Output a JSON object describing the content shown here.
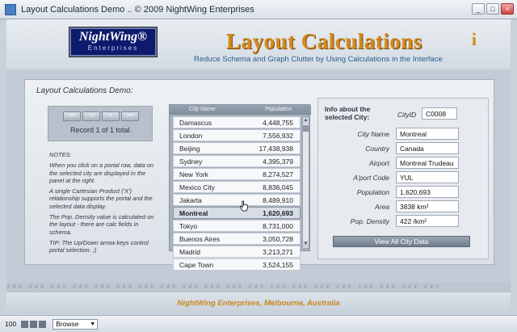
{
  "window": {
    "title": "Layout Calculations Demo  ..  © 2009 NightWing Enterprises",
    "controls": [
      "_",
      "□",
      "×"
    ]
  },
  "header": {
    "logo_main": "NightWing®",
    "logo_sub": "Enterprises",
    "title": "Layout Calculations",
    "subtitle": "Reduce Schema and Graph Clutter by Using Calculations in the Interface",
    "info_icon": "i"
  },
  "panel": {
    "title": "Layout Calculations Demo:",
    "nav": [
      "<<",
      "<",
      ">",
      ">>"
    ],
    "record_count": "Record 1 of 1 total.",
    "notes": [
      "NOTES:",
      "When you click on a portal row, data on the selected city are displayed in the panel at the right.",
      "A single Cartesian Product ('X') relationship supports the portal and the selected data display.",
      "The Pop. Density value is calculated on the layout - there are calc fields in schema.",
      "TIP: The Up/Down arrow keys control portal selection. ;)"
    ]
  },
  "portal": {
    "col_name": "City Name",
    "col_pop": "Population",
    "rows": [
      {
        "name": "Damascus",
        "pop": "4,448,755"
      },
      {
        "name": "London",
        "pop": "7,556,932"
      },
      {
        "name": "Beijing",
        "pop": "17,438,938"
      },
      {
        "name": "Sydney",
        "pop": "4,395,379"
      },
      {
        "name": "New York",
        "pop": "8,274,527"
      },
      {
        "name": "Mexico City",
        "pop": "8,836,045"
      },
      {
        "name": "Jakarta",
        "pop": "8,489,910"
      },
      {
        "name": "Montreal",
        "pop": "1,620,693"
      },
      {
        "name": "Tokyo",
        "pop": "8,731,000"
      },
      {
        "name": "Buenos Aires",
        "pop": "3,050,728"
      },
      {
        "name": "Madrid",
        "pop": "3,213,271"
      },
      {
        "name": "Cape Town",
        "pop": "3,524,155"
      }
    ],
    "selected_index": 7
  },
  "details": {
    "heading": "Info about the selected City:",
    "cityid_label": "CityID",
    "cityid_value": "C0008",
    "fields": [
      {
        "label": "City Name",
        "value": "Montreal"
      },
      {
        "label": "Country",
        "value": "Canada"
      },
      {
        "label": "Airport",
        "value": "Montreal Trudeau"
      },
      {
        "label": "A'port Code",
        "value": "YUL"
      },
      {
        "label": "Population",
        "value": "1,620,693"
      },
      {
        "label": "Area",
        "value": "3838 km²"
      },
      {
        "label": "Pop. Density",
        "value": "422 /km²"
      }
    ],
    "view_all": "View All City Data"
  },
  "band_text": "X4X  X4X  X4X  X4X  X4X  X4X  X4X  X4X  X4X  X4X  X4X  X4X  X4X  X4X  X4X  X4X  X4X  X4X  X4X  X4X",
  "footer": "NightWing Enterprises, Melbourne, Australia",
  "status": {
    "zoom": "100",
    "mode": "Browse"
  }
}
